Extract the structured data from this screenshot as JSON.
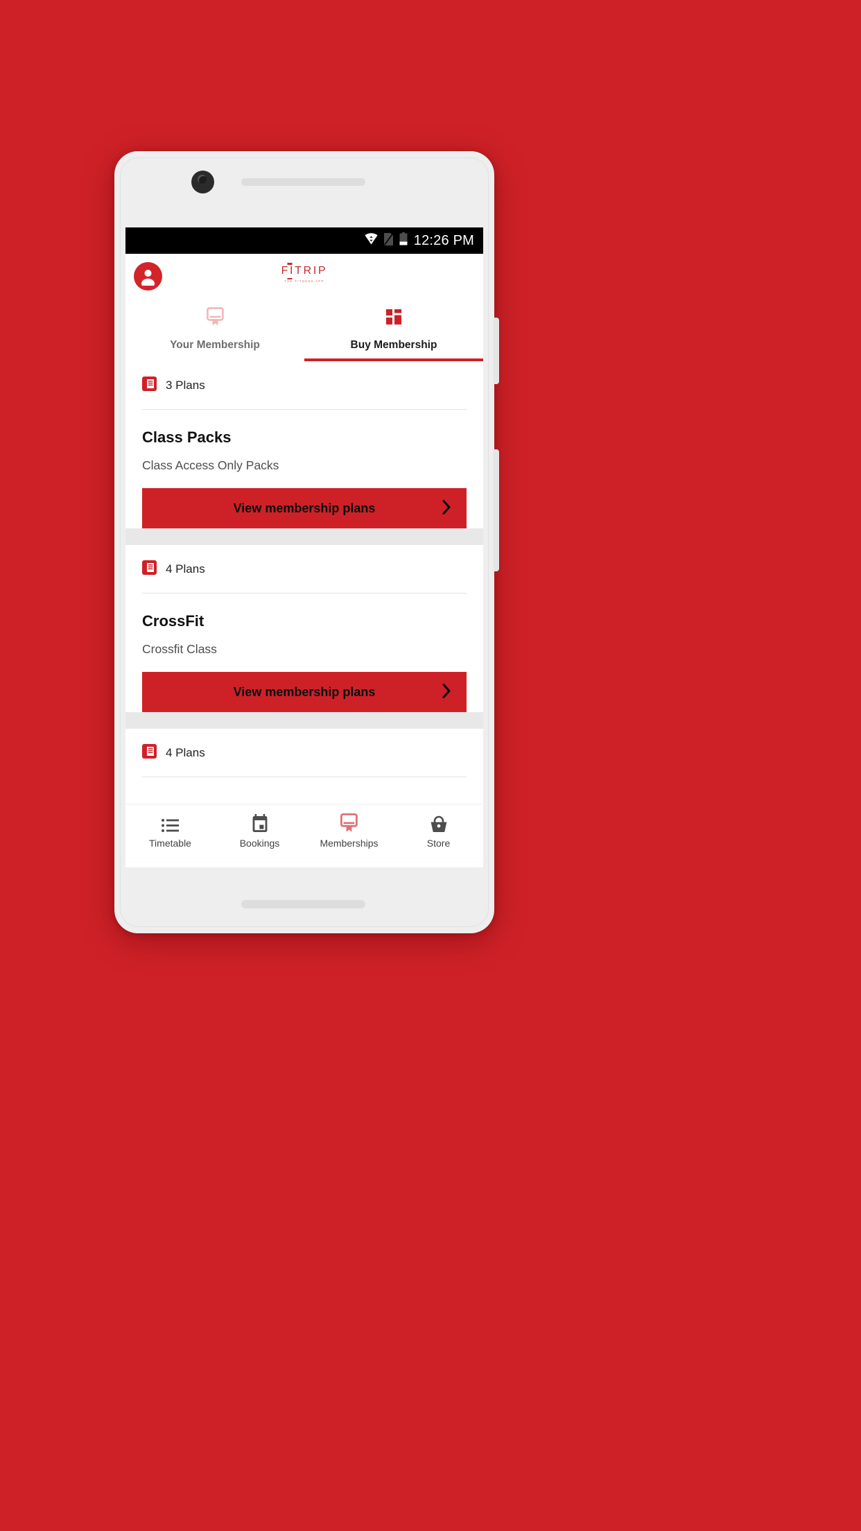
{
  "theme": {
    "background_red": "#ce2127",
    "brand_red": "#c9272d",
    "button_red": "#ce2127",
    "active_nav_red": "#dd7276",
    "inactive_tab_icon": "#f0b6b8"
  },
  "statusbar": {
    "time": "12:26 PM",
    "icons": [
      "wifi-icon",
      "no-sim-icon",
      "battery-icon"
    ]
  },
  "header": {
    "avatar_icon": "account-circle-icon",
    "brand_name": "FITRIP",
    "brand_tagline": "THE FITNESS APP"
  },
  "tabs": [
    {
      "label": "Your Membership",
      "icon": "membership-card-icon",
      "active": false
    },
    {
      "label": "Buy Membership",
      "icon": "grid-dashboard-icon",
      "active": true
    }
  ],
  "plans": [
    {
      "count_label": "3 Plans",
      "count_icon": "plan-list-icon",
      "title": "Class Packs",
      "description": "Class Access Only Packs",
      "button_label": "View membership plans",
      "button_icon": "chevron-right-icon"
    },
    {
      "count_label": "4 Plans",
      "count_icon": "plan-list-icon",
      "title": "CrossFit",
      "description": "Crossfit Class",
      "button_label": "View membership plans",
      "button_icon": "chevron-right-icon"
    },
    {
      "count_label": "4 Plans",
      "count_icon": "plan-list-icon",
      "title": "",
      "description": "",
      "button_label": "",
      "button_icon": "chevron-right-icon"
    }
  ],
  "bottom_nav": [
    {
      "label": "Timetable",
      "icon": "list-icon",
      "active": false
    },
    {
      "label": "Bookings",
      "icon": "calendar-icon",
      "active": false
    },
    {
      "label": "Memberships",
      "icon": "membership-card-icon",
      "active": true
    },
    {
      "label": "Store",
      "icon": "basket-icon",
      "active": false
    }
  ]
}
